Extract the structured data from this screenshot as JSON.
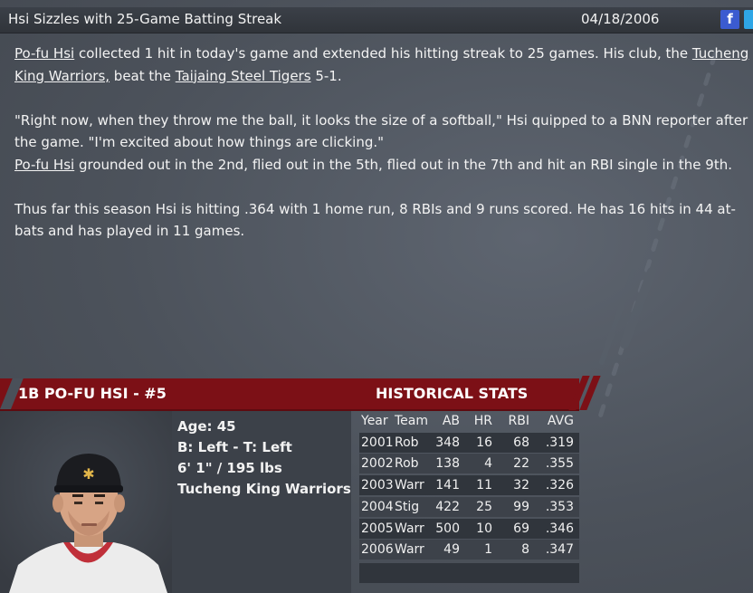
{
  "header": {
    "headline": "Hsi Sizzles with 25-Game Batting Streak",
    "date": "04/18/2006",
    "facebook_icon_label": "f",
    "icons": [
      "facebook-icon",
      "twitter-icon"
    ]
  },
  "article": {
    "p1": {
      "player_link": "Po-fu Hsi",
      "text1": " collected 1 hit in today's game and extended his hitting streak to 25 games. His club, the ",
      "team_link": "Tucheng King Warriors,",
      "text2": " beat the ",
      "opponent_link": "Taijaing Steel Tigers",
      "text3": " 5-1."
    },
    "p2": {
      "quote": "\"Right now, when they throw me the ball, it looks the size of a softball,\" Hsi quipped to a BNN reporter after the game. \"I'm excited about how things are clicking.\"",
      "player_link": "Po-fu Hsi",
      "text": " grounded out in the 2nd, flied out in the 5th, flied out in the 7th and hit an RBI single in the 9th."
    },
    "p3": "Thus far this season Hsi is hitting .364 with 1 home run, 8 RBIs and 9 runs scored. He has 16 hits in 44 at-bats and has played in 11 games."
  },
  "player": {
    "banner_title": "1B PO-FU HSI - #5",
    "age": "Age: 45",
    "bats_throws": "B: Left - T: Left",
    "height_weight": "6' 1\" / 195 lbs",
    "team": "Tucheng King Warriors"
  },
  "historical": {
    "title": "HISTORICAL STATS",
    "headers": {
      "year": "Year",
      "team": "Team",
      "ab": "AB",
      "hr": "HR",
      "rbi": "RBI",
      "avg": "AVG"
    },
    "rows": [
      {
        "year": "2001",
        "team": "Rob",
        "ab": "348",
        "hr": "16",
        "rbi": "68",
        "avg": ".319"
      },
      {
        "year": "2002",
        "team": "Rob",
        "ab": "138",
        "hr": "4",
        "rbi": "22",
        "avg": ".355"
      },
      {
        "year": "2003",
        "team": "Warr",
        "ab": "141",
        "hr": "11",
        "rbi": "32",
        "avg": ".326"
      },
      {
        "year": "2004",
        "team": "Stig",
        "ab": "422",
        "hr": "25",
        "rbi": "99",
        "avg": ".353"
      },
      {
        "year": "2005",
        "team": "Warr",
        "ab": "500",
        "hr": "10",
        "rbi": "69",
        "avg": ".346"
      },
      {
        "year": "2006",
        "team": "Warr",
        "ab": "49",
        "hr": "1",
        "rbi": "8",
        "avg": ".347"
      }
    ]
  },
  "colors": {
    "banner": "#7c1016",
    "background": "#4a5059",
    "facebook": "#3b5bd0",
    "twitter": "#2fa6e6"
  }
}
